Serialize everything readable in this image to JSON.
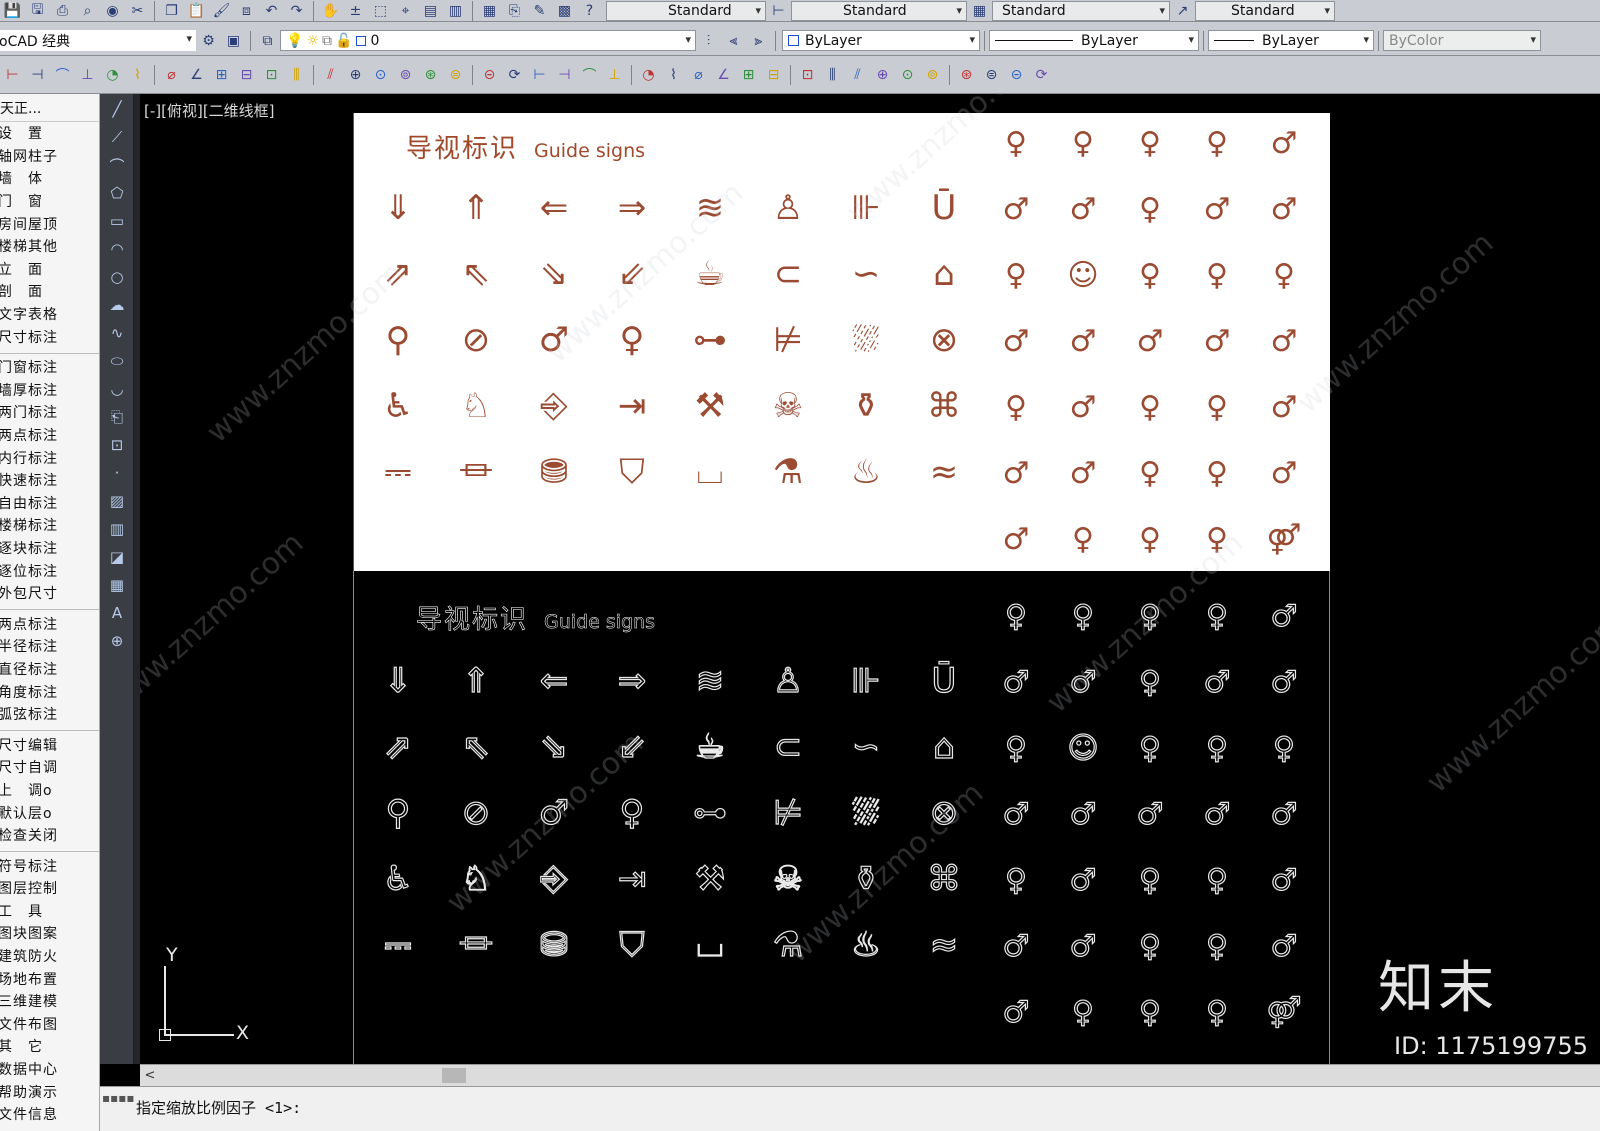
{
  "toolbar_row1": {
    "icons": [
      "save-icon",
      "save-as-icon",
      "print-icon",
      "plot-preview-icon",
      "publish-icon",
      "cut-icon",
      "copy-icon",
      "paste-icon",
      "match-properties-icon",
      "block-editor-icon",
      "undo-icon",
      "redo-icon",
      "pan-icon",
      "zoom-realtime-icon",
      "zoom-window-icon",
      "zoom-previous-icon",
      "properties-icon",
      "design-center-icon",
      "tool-palettes-icon",
      "sheet-set-icon",
      "markup-icon",
      "quickcalc-icon",
      "help-icon"
    ],
    "text_style": "Standard",
    "dim_style": "Standard",
    "table_style": "Standard",
    "multileader_style": "Standard"
  },
  "toolbar_row2": {
    "workspace": "oCAD 经典",
    "layer_value": "0",
    "color": "ByLayer",
    "linetype": "ByLayer",
    "lineweight": "ByLayer",
    "plot_style": "ByColor"
  },
  "toolbar_row3": {
    "icons": [
      "dim-linear-icon",
      "dim-aligned-icon",
      "dim-arc-icon",
      "dim-ordinate-icon",
      "dim-radius-icon",
      "dim-jogged-icon",
      "dim-diameter-icon",
      "dim-angular-icon",
      "quick-dim-icon",
      "baseline-icon",
      "continue-icon",
      "dim-space-icon",
      "dim-break-icon",
      "tolerance-icon",
      "center-mark-icon",
      "inspection-icon",
      "jogged-linear-icon",
      "dim-edit-icon",
      "dim-text-edit-icon",
      "dim-update-icon",
      "layer-icon",
      "layer-state-icon",
      "light-icon",
      "sun-icon",
      "render-icon",
      "material-icon",
      "camera-icon",
      "walk-icon",
      "fly-icon",
      "view-icon",
      "named-view-icon",
      "viewport-icon",
      "ucs-icon",
      "world-ucs-icon",
      "origin-icon",
      "x-axis-icon",
      "y-axis-icon",
      "z-axis-icon",
      "3-point-icon",
      "apply-icon"
    ]
  },
  "palette": {
    "header": "天正...",
    "groups": [
      [
        "设　置",
        "轴网柱子",
        "墙　体",
        "门　窗",
        "房间屋顶",
        "楼梯其他",
        "立　面",
        "剖　面",
        "文字表格",
        "尺寸标注"
      ],
      [
        "门窗标注",
        "墙厚标注",
        "两门标注",
        "两点标注",
        "内行标注",
        "快速标注",
        "自由标注",
        "楼梯标注",
        "逐块标注",
        "逐位标注",
        "外包尺寸"
      ],
      [
        "两点标注",
        "半径标注",
        "直径标注",
        "角度标注",
        "弧弦标注"
      ],
      [
        "尺寸编辑",
        "尺寸自调",
        "上　调o",
        "默认层o",
        "检查关闭"
      ],
      [
        "符号标注",
        "图层控制",
        "工　具",
        "图块图案",
        "建筑防火",
        "场地布置",
        "三维建模",
        "文件布图",
        "其　它",
        "数据中心",
        "帮助演示",
        "文件信息"
      ]
    ]
  },
  "draw_tools": [
    "line-icon",
    "construction-line-icon",
    "polyline-icon",
    "polygon-icon",
    "rectangle-icon",
    "arc-icon",
    "circle-icon",
    "revision-cloud-icon",
    "spline-icon",
    "ellipse-icon",
    "ellipse-arc-icon",
    "insert-block-icon",
    "make-block-icon",
    "point-icon",
    "hatch-icon",
    "gradient-icon",
    "region-icon",
    "table-icon",
    "multiline-text-icon",
    "add-selected-icon"
  ],
  "viewport": {
    "label": "[-][俯视][二维线框]",
    "ucs": {
      "y": "Y",
      "x": "X"
    }
  },
  "sheet": {
    "title_cn": "导视标识",
    "title_en": "Guide signs",
    "symbols": [
      {
        "name": "arrow-down-icon",
        "glyph": "⇓"
      },
      {
        "name": "arrow-up-icon",
        "glyph": "⇑"
      },
      {
        "name": "arrow-left-icon",
        "glyph": "⇐"
      },
      {
        "name": "arrow-right-icon",
        "glyph": "⇒"
      },
      {
        "name": "swimming-icon",
        "glyph": "≋"
      },
      {
        "name": "bowling-icon",
        "glyph": "♙"
      },
      {
        "name": "dumbbell-icon",
        "glyph": "⊪"
      },
      {
        "name": "drink-icon",
        "glyph": "Ū"
      },
      {
        "name": "arrow-up-right-icon",
        "glyph": "⇗"
      },
      {
        "name": "arrow-up-left-icon",
        "glyph": "⇖"
      },
      {
        "name": "arrow-down-right-icon",
        "glyph": "⇘"
      },
      {
        "name": "arrow-down-left-icon",
        "glyph": "⇙"
      },
      {
        "name": "coffee-cup-icon",
        "glyph": "☕"
      },
      {
        "name": "paper-clip-icon",
        "glyph": "⊂"
      },
      {
        "name": "link-icon",
        "glyph": "∽"
      },
      {
        "name": "hanger-icon",
        "glyph": "⌂"
      },
      {
        "name": "walking-person-icon",
        "glyph": "⚲"
      },
      {
        "name": "no-running-icon",
        "glyph": "⊘"
      },
      {
        "name": "man-icon",
        "glyph": "♂"
      },
      {
        "name": "woman-icon",
        "glyph": "♀"
      },
      {
        "name": "smoking-icon",
        "glyph": "⊶"
      },
      {
        "name": "no-smoking-icon",
        "glyph": "⊭"
      },
      {
        "name": "shower-icon",
        "glyph": "⛆"
      },
      {
        "name": "no-swimming-icon",
        "glyph": "⊗"
      },
      {
        "name": "wheelchair-icon",
        "glyph": "♿"
      },
      {
        "name": "seated-person-icon",
        "glyph": "♘"
      },
      {
        "name": "exit-door-icon",
        "glyph": "⎆"
      },
      {
        "name": "exit-arrow-icon",
        "glyph": "⇥"
      },
      {
        "name": "wrench-icon",
        "glyph": "⚒"
      },
      {
        "name": "skull-icon",
        "glyph": "☠"
      },
      {
        "name": "fire-extinguisher-icon",
        "glyph": "⚱"
      },
      {
        "name": "fire-hose-icon",
        "glyph": "⌘"
      },
      {
        "name": "massage-icon",
        "glyph": "⎓"
      },
      {
        "name": "massage-bed-icon",
        "glyph": "⏛"
      },
      {
        "name": "dress-icon",
        "glyph": "⛃"
      },
      {
        "name": "shirt-icon",
        "glyph": "⛉"
      },
      {
        "name": "trash-bin-icon",
        "glyph": "⌴"
      },
      {
        "name": "flask-icon",
        "glyph": "⚗"
      },
      {
        "name": "hot-spring-icon",
        "glyph": "♨"
      },
      {
        "name": "wind-icon",
        "glyph": "≈"
      }
    ],
    "figures": [
      "woman-figure-icon",
      "woman-figure-icon",
      "woman-figure-icon",
      "woman-figure-icon",
      "man-figure-icon",
      "man-figure-icon",
      "man-figure-icon",
      "woman-figure-icon",
      "man-figure-icon",
      "man-figure-icon",
      "woman-figure-icon",
      "child-figure-icon",
      "woman-figure-icon",
      "woman-figure-icon",
      "woman-figure-icon",
      "man-figure-icon",
      "man-figure-icon",
      "man-figure-icon",
      "man-figure-icon",
      "man-figure-icon",
      "woman-figure-icon",
      "man-figure-icon",
      "woman-figure-icon",
      "woman-figure-icon",
      "man-figure-icon",
      "man-figure-icon",
      "man-figure-icon",
      "woman-figure-icon",
      "woman-figure-icon",
      "man-figure-icon",
      "man-figure-icon",
      "woman-figure-icon",
      "woman-figure-icon",
      "woman-figure-icon",
      "couple-figure-icon"
    ]
  },
  "watermark": {
    "site": "www.znzmo.com",
    "brand": "知末",
    "image_id": "ID: 1175199755"
  },
  "command_line": {
    "prompt": "指定缩放比例因子 <1>:"
  },
  "colors": {
    "sign_brown": "#9a4b32",
    "canvas": "#000000",
    "sheet": "#ffffff"
  }
}
